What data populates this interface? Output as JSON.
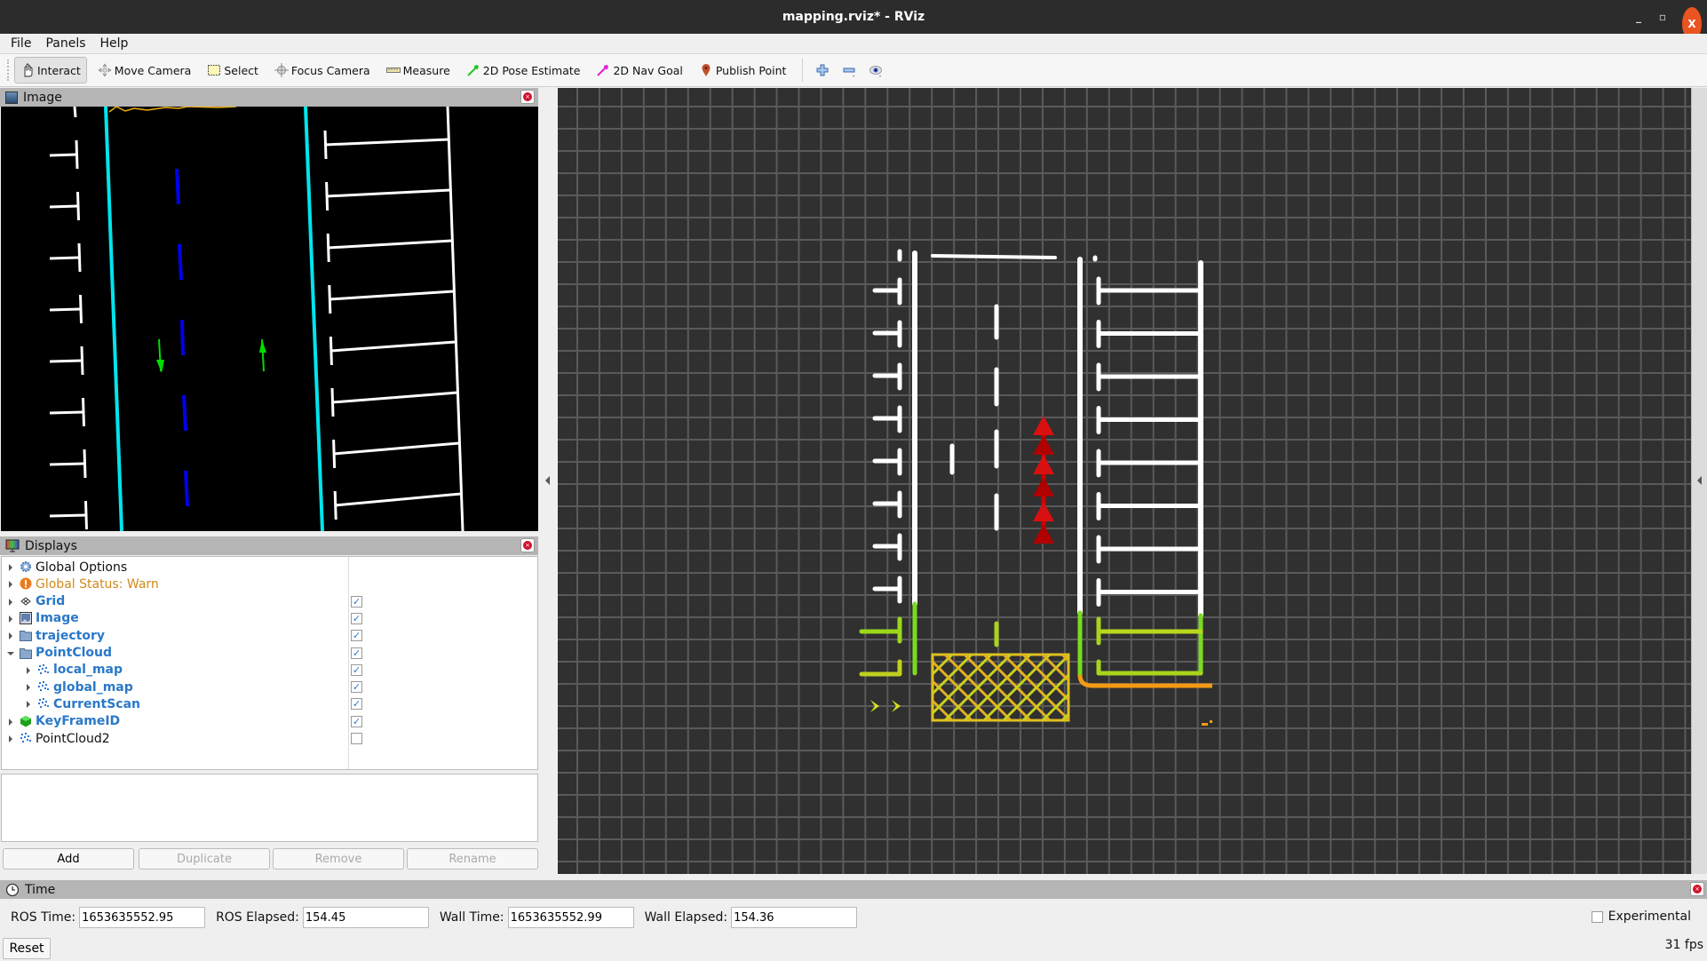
{
  "window": {
    "title": "mapping.rviz* - RViz",
    "controls": {
      "minimize": "_",
      "maximize": "▫",
      "close": "X"
    }
  },
  "menu": [
    "File",
    "Panels",
    "Help"
  ],
  "toolbar": {
    "tools": [
      {
        "label": "Interact",
        "icon": "hand-pointer-icon",
        "active": true
      },
      {
        "label": "Move Camera",
        "icon": "move-camera-icon",
        "active": false
      },
      {
        "label": "Select",
        "icon": "select-box-icon",
        "active": false
      },
      {
        "label": "Focus Camera",
        "icon": "crosshair-icon",
        "active": false
      },
      {
        "label": "Measure",
        "icon": "ruler-icon",
        "active": false
      },
      {
        "label": "2D Pose Estimate",
        "icon": "green-arrow-icon",
        "active": false
      },
      {
        "label": "2D Nav Goal",
        "icon": "magenta-arrow-icon",
        "active": false
      },
      {
        "label": "Publish Point",
        "icon": "map-pin-icon",
        "active": false
      }
    ],
    "extra_icons": [
      "plus-icon",
      "minus-icon",
      "eye-icon"
    ]
  },
  "image_panel": {
    "title": "Image"
  },
  "displays_panel": {
    "title": "Displays",
    "items": [
      {
        "label": "Global Options",
        "icon": "gear-icon",
        "style": "normal",
        "indent": 0,
        "expanded": false,
        "checkbox": null
      },
      {
        "label": "Global Status: Warn",
        "icon": "warning-icon",
        "style": "warn",
        "indent": 0,
        "expanded": false,
        "checkbox": null
      },
      {
        "label": "Grid",
        "icon": "grid-icon",
        "style": "blue",
        "indent": 0,
        "expanded": false,
        "checkbox": true
      },
      {
        "label": "Image",
        "icon": "image-icon",
        "style": "blue",
        "indent": 0,
        "expanded": false,
        "checkbox": true
      },
      {
        "label": "trajectory",
        "icon": "folder-icon",
        "style": "blue",
        "indent": 0,
        "expanded": false,
        "checkbox": true
      },
      {
        "label": "PointCloud",
        "icon": "folder-icon",
        "style": "blue",
        "indent": 0,
        "expanded": true,
        "checkbox": true
      },
      {
        "label": "local_map",
        "icon": "pointcloud-icon",
        "style": "blue",
        "indent": 1,
        "expanded": false,
        "checkbox": true
      },
      {
        "label": "global_map",
        "icon": "pointcloud-icon",
        "style": "blue",
        "indent": 1,
        "expanded": false,
        "checkbox": true
      },
      {
        "label": "CurrentScan",
        "icon": "pointcloud-icon",
        "style": "blue",
        "indent": 1,
        "expanded": false,
        "checkbox": true
      },
      {
        "label": "KeyFrameID",
        "icon": "green-cube-icon",
        "style": "blue",
        "indent": 0,
        "expanded": false,
        "checkbox": true
      },
      {
        "label": "PointCloud2",
        "icon": "pointcloud-icon",
        "style": "normal",
        "indent": 0,
        "expanded": false,
        "checkbox": false
      }
    ],
    "buttons": [
      {
        "label": "Add",
        "enabled": true
      },
      {
        "label": "Duplicate",
        "enabled": false
      },
      {
        "label": "Remove",
        "enabled": false
      },
      {
        "label": "Rename",
        "enabled": false
      }
    ]
  },
  "time_panel": {
    "title": "Time",
    "ros_time_label": "ROS Time:",
    "ros_time": "1653635552.95",
    "ros_elapsed_label": "ROS Elapsed:",
    "ros_elapsed": "154.45",
    "wall_time_label": "Wall Time:",
    "wall_time": "1653635552.99",
    "wall_elapsed_label": "Wall Elapsed:",
    "wall_elapsed": "154.36",
    "experimental_label": "Experimental",
    "experimental_checked": false,
    "reset_label": "Reset",
    "fps": "31 fps"
  },
  "colors": {
    "viewport_bg": "#303030",
    "grid_line": "#5a5a5a",
    "lane_cyan": "#00e5ee",
    "lane_blue": "#0000ee",
    "arrow_green": "#00dd00",
    "marking_white": "#ffffff",
    "trajectory_red": "#cc0000",
    "warn_orange": "#d08a1a",
    "link_blue": "#2a78c8"
  }
}
